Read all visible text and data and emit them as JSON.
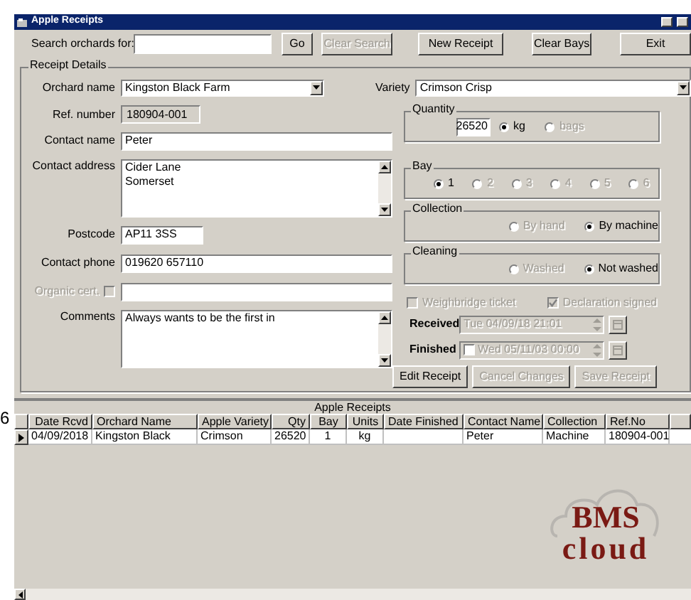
{
  "side_mark": "6",
  "window": {
    "title": "Apple Receipts"
  },
  "search": {
    "label": "Search orchards for:"
  },
  "toolbar_buttons": [
    {
      "label": "Go",
      "disabled": false
    },
    {
      "label": "Clear Search",
      "disabled": true
    },
    {
      "label": "New Receipt",
      "disabled": false
    },
    {
      "label": "Clear Bays",
      "disabled": false
    },
    {
      "label": "Exit",
      "disabled": false
    }
  ],
  "receipt_details": {
    "title": "Receipt Details",
    "fields": [
      {
        "kind": "combo",
        "label": "Orchard name",
        "value": "Kingston Black Farm"
      },
      {
        "kind": "readonly",
        "label": "Ref. number",
        "value": "180904-001"
      },
      {
        "kind": "text",
        "label": "Contact name",
        "value": "Peter"
      },
      {
        "kind": "textarea",
        "label": "Contact address",
        "value": "Cider Lane\nSomerset"
      },
      {
        "kind": "short",
        "label": "Postcode",
        "value": "AP11 3SS"
      },
      {
        "kind": "text",
        "label": "Contact phone",
        "value": "019620 657110"
      },
      {
        "kind": "checktext",
        "label": "Organic cert.",
        "disabled": true,
        "checked": false
      },
      {
        "kind": "textarea",
        "label": "Comments",
        "value": "Always wants to be the first in"
      }
    ],
    "variety": {
      "label": "Variety",
      "value": "Crimson Crisp"
    },
    "option_groups": [
      {
        "title": "Quantity",
        "value": "26520",
        "options": [
          {
            "label": "kg",
            "selected": true,
            "disabled": false
          },
          {
            "label": "bags",
            "selected": false,
            "disabled": true
          }
        ]
      },
      {
        "title": "Bay",
        "options": [
          {
            "label": "1",
            "selected": true,
            "disabled": false
          },
          {
            "label": "2",
            "selected": false,
            "disabled": true
          },
          {
            "label": "3",
            "selected": false,
            "disabled": true
          },
          {
            "label": "4",
            "selected": false,
            "disabled": true
          },
          {
            "label": "5",
            "selected": false,
            "disabled": true
          },
          {
            "label": "6",
            "selected": false,
            "disabled": true
          }
        ]
      },
      {
        "title": "Collection",
        "options": [
          {
            "label": "By hand",
            "selected": false,
            "disabled": true
          },
          {
            "label": "By machine",
            "selected": true,
            "disabled": false
          }
        ]
      },
      {
        "title": "Cleaning",
        "options": [
          {
            "label": "Washed",
            "selected": false,
            "disabled": true
          },
          {
            "label": "Not washed",
            "selected": true,
            "disabled": false
          }
        ]
      }
    ],
    "checks": [
      {
        "label": "Weighbridge ticket",
        "checked": false,
        "disabled": true
      },
      {
        "label": "Declaration signed",
        "checked": true,
        "disabled": true
      }
    ],
    "dates": [
      {
        "kind": "plain",
        "label": "Received",
        "value": "Tue 04/09/18 21:01",
        "disabled": true
      },
      {
        "kind": "checkable",
        "label": "Finished",
        "value": "Wed 05/11/03 00:00",
        "checked": false,
        "disabled": true
      }
    ],
    "actions": [
      {
        "label": "Edit Receipt",
        "disabled": false
      },
      {
        "label": "Cancel Changes",
        "disabled": true
      },
      {
        "label": "Save Receipt",
        "disabled": true
      }
    ]
  },
  "grid": {
    "caption": "Apple Receipts",
    "columns": [
      "Date Rcvd",
      "Orchard Name",
      "Apple Variety",
      "Qty",
      "Bay",
      "Units",
      "Date Finished",
      "Contact Name",
      "Collection",
      "Ref.No"
    ],
    "rows": [
      {
        "current": true,
        "cells": [
          "04/09/2018",
          "Kingston Black",
          "Crimson",
          "26520",
          "1",
          "kg",
          "",
          "Peter",
          "Machine",
          "180904-001"
        ]
      }
    ]
  },
  "logo": {
    "line1": "BMS",
    "line2": "cloud"
  }
}
